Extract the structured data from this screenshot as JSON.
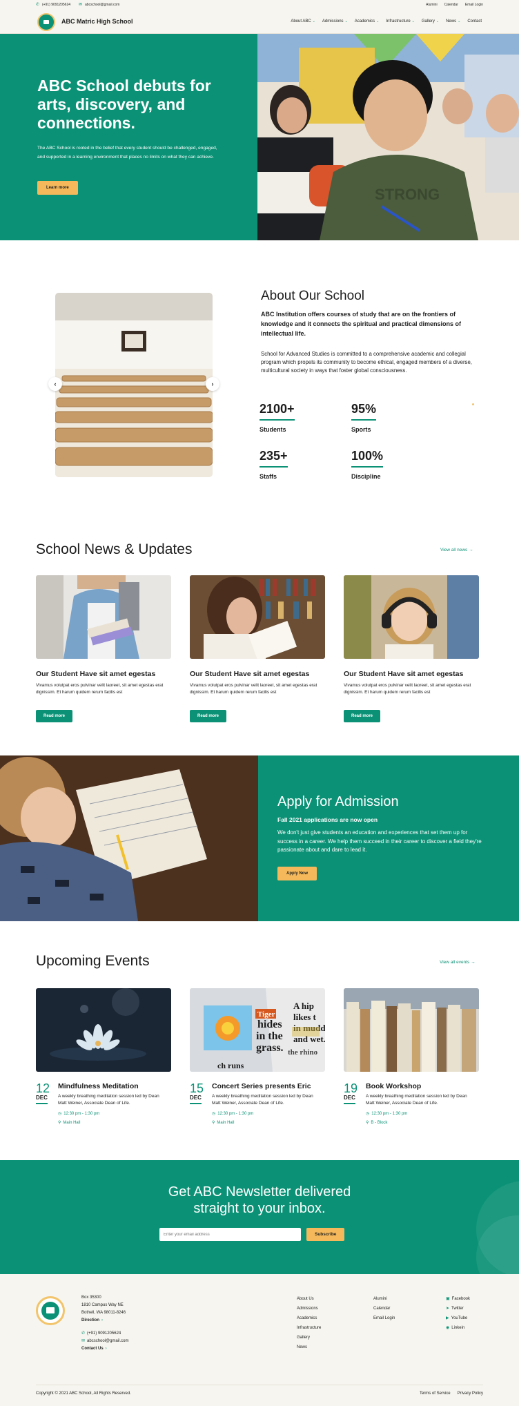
{
  "topbar": {
    "phone": "(+91) 9091205624",
    "email": "abcschool@gmail.com",
    "links": [
      "Alumini",
      "Calendar",
      "Email Login"
    ]
  },
  "header": {
    "brand": "ABC Matric High School",
    "nav": [
      {
        "label": "About ABC",
        "dropdown": true
      },
      {
        "label": "Admissions",
        "dropdown": true
      },
      {
        "label": "Academics",
        "dropdown": true
      },
      {
        "label": "Infrastructure",
        "dropdown": true
      },
      {
        "label": "Gallery",
        "dropdown": true
      },
      {
        "label": "News",
        "dropdown": true
      },
      {
        "label": "Contact",
        "dropdown": false
      }
    ]
  },
  "hero": {
    "title": "ABC School debuts for arts, discovery, and connections.",
    "text": "The ABC School is rooted in the belief that every student should be challenged, engaged, and supported in a learning environment that places no limits on what they can achieve.",
    "button": "Learn more"
  },
  "about": {
    "title": "About Our School",
    "lead": "ABC Institution offers courses of study that are on the frontiers of knowledge and it connects the spiritual and practical dimensions of intellectual life.",
    "body": "School for Advanced Studies is committed to a comprehensive academic and collegial program which propels its community to become ethical, engaged  members of a diverse, multicultural society in ways that foster global consciousness.",
    "stats": [
      {
        "value": "2100+",
        "label": "Students"
      },
      {
        "value": "95%",
        "label": "Sports"
      },
      {
        "value": "235+",
        "label": "Staffs"
      },
      {
        "value": "100%",
        "label": "Discipline"
      }
    ]
  },
  "news": {
    "title": "School News & Updates",
    "view_all": "View all news",
    "cards": [
      {
        "title": "Our Student Have sit amet egestas",
        "text": "Vivamus volutpat eros pulvinar velit laoreet, sit amet egestas erat dignissim. Et harum quidem rerum facilis est",
        "button": "Read more"
      },
      {
        "title": "Our Student Have sit amet egestas",
        "text": "Vivamus volutpat eros pulvinar velit laoreet, sit amet egestas erat dignissim. Et harum quidem rerum facilis est",
        "button": "Read more"
      },
      {
        "title": "Our Student Have sit amet egestas",
        "text": "Vivamus volutpat eros pulvinar velit laoreet, sit amet egestas erat dignissim. Et harum quidem rerum facilis est",
        "button": "Read more"
      }
    ]
  },
  "admission": {
    "title": "Apply for Admission",
    "subtitle": "Fall 2021 applications are now open",
    "text": "We don't just give students an education and experiences that set them up for success in a career. We help them succeed in their career to discover a field they're passionate about and dare to lead it.",
    "button": "Apply Now"
  },
  "events": {
    "title": "Upcoming Events",
    "view_all": "View all events",
    "items": [
      {
        "day": "12",
        "month": "DEC",
        "title": "Mindfulness Meditation",
        "text": "A weekly breathing meditation session led by Dean Matt Weiner, Associate Dean of Life.",
        "time": "12:30 pm - 1:30 pm",
        "place": "Main Hall"
      },
      {
        "day": "15",
        "month": "DEC",
        "title": "Concert Series presents Eric",
        "text": "A weekly breathing meditation session led by Dean Matt Weiner, Associate Dean of Life.",
        "time": "12:30 pm - 1:30 pm",
        "place": "Main Hall"
      },
      {
        "day": "19",
        "month": "DEC",
        "title": "Book Workshop",
        "text": "A weekly breathing meditation session led by Dean Matt Weiner, Associate Dean of Life.",
        "time": "12:30 pm - 1:30 pm",
        "place": "B - Block"
      }
    ],
    "newspaper_words": [
      "Tiger",
      "hides",
      "in the",
      "grass.",
      "A hip",
      "likes t",
      "in mudd",
      "and wet.",
      "the rhino",
      "ch runs"
    ]
  },
  "newsletter": {
    "title_line1": "Get ABC Newsletter delivered",
    "title_line2": "straight to your inbox.",
    "placeholder": "Enter your email address",
    "button": "Subscribe"
  },
  "footer": {
    "address": [
      "Box 35300",
      "1810 Campus Way NE",
      "Bothell, WA 98011-8246"
    ],
    "direction": "Direction",
    "phone": "(+91) 9091205624",
    "email": "abcschool@gmail.com",
    "contact": "Contact Us",
    "col1": [
      "About Us",
      "Admissions",
      "Academics",
      "Infrastructure",
      "Gallery",
      "News"
    ],
    "col2": [
      "Alumini",
      "Calendar",
      "Email Login"
    ],
    "social": [
      {
        "label": "Facebook",
        "icon": "facebook-icon"
      },
      {
        "label": "Twitter",
        "icon": "twitter-icon"
      },
      {
        "label": "YouTube",
        "icon": "youtube-icon"
      },
      {
        "label": "Linkein",
        "icon": "linkedin-icon"
      }
    ],
    "copyright": "Copyright © 2021 ABC School, All Rights Reserved.",
    "terms": "Terms of Service",
    "privacy": "Privacy Policy"
  },
  "colors": {
    "primary": "#0b9276",
    "accent": "#f5b95b",
    "background": "#f6f5ef"
  }
}
